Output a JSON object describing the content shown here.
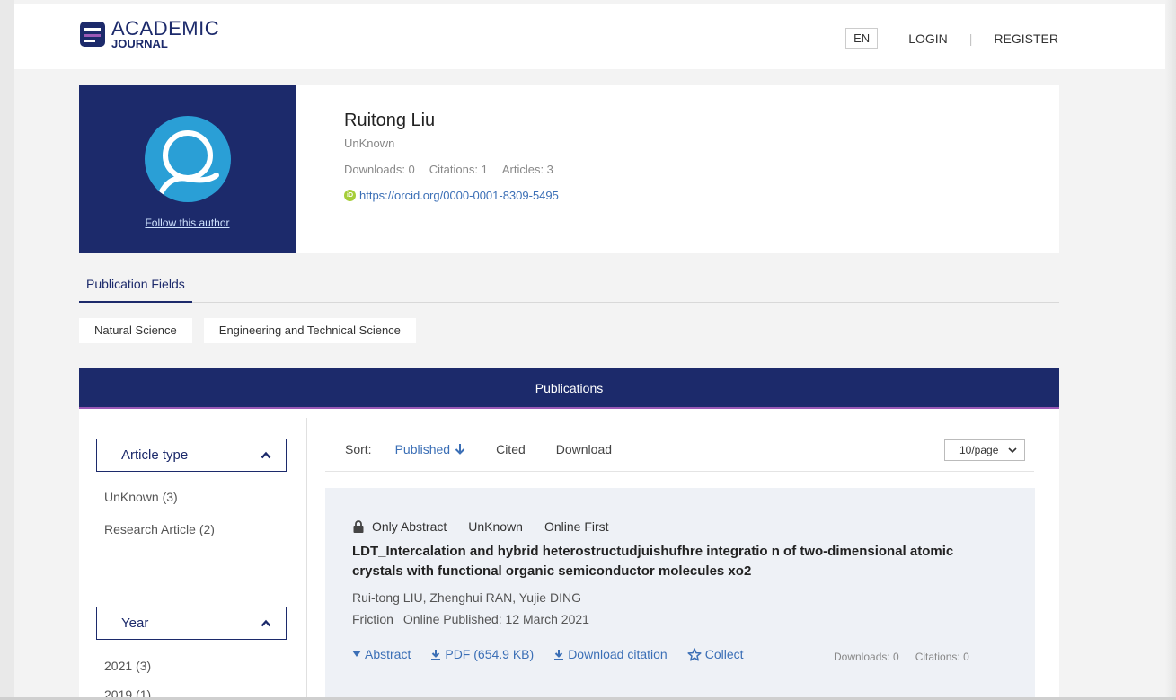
{
  "header": {
    "logo_academic": "ACADEMIC",
    "logo_journal": "JOURNAL",
    "lang": "EN",
    "login": "LOGIN",
    "divider": "|",
    "register": "REGISTER"
  },
  "author": {
    "name": "Ruitong Liu",
    "affiliation": "UnKnown",
    "downloads": "Downloads: 0",
    "citations": "Citations: 1",
    "articles": "Articles: 3",
    "orcid_badge": "iD",
    "orcid_url": "https://orcid.org/0000-0001-8309-5495",
    "follow": "Follow this author"
  },
  "fields": {
    "tab_label": "Publication Fields",
    "chips": [
      "Natural Science",
      "Engineering and Technical Science"
    ]
  },
  "publications": {
    "header": "Publications",
    "filters": {
      "article_type": {
        "label": "Article type",
        "items": [
          "UnKnown (3)",
          "Research Article (2)"
        ]
      },
      "year": {
        "label": "Year",
        "items": [
          "2021 (3)",
          "2019 (1)"
        ]
      }
    },
    "sort": {
      "label": "Sort:",
      "options": [
        "Published",
        "Cited",
        "Download"
      ],
      "active": "Published",
      "per_page": "10/page"
    },
    "articles": [
      {
        "access": "Only Abstract",
        "type": "UnKnown",
        "status": "Online First",
        "title": "LDT_Intercalation and hybrid heterostructudjuishufhre integratio n of two-dimensional atomic crystals with functional organic semiconductor molecules xo2",
        "authors": "Rui-tong LIU, Zhenghui RAN, Yujie DING",
        "journal": "Friction",
        "published": "Online Published: 12 March 2021",
        "actions": {
          "abstract": "Abstract",
          "pdf": "PDF (654.9 KB)",
          "download_citation": "Download citation",
          "collect": "Collect"
        },
        "downloads": "Downloads: 0",
        "citations": "Citations: 0"
      }
    ]
  },
  "colors": {
    "navy": "#1c2a6b",
    "link_blue": "#3b6fb6",
    "avatar_blue": "#2a9fd6",
    "accent_purple": "#9b59b6",
    "orcid_green": "#a6ce39"
  }
}
